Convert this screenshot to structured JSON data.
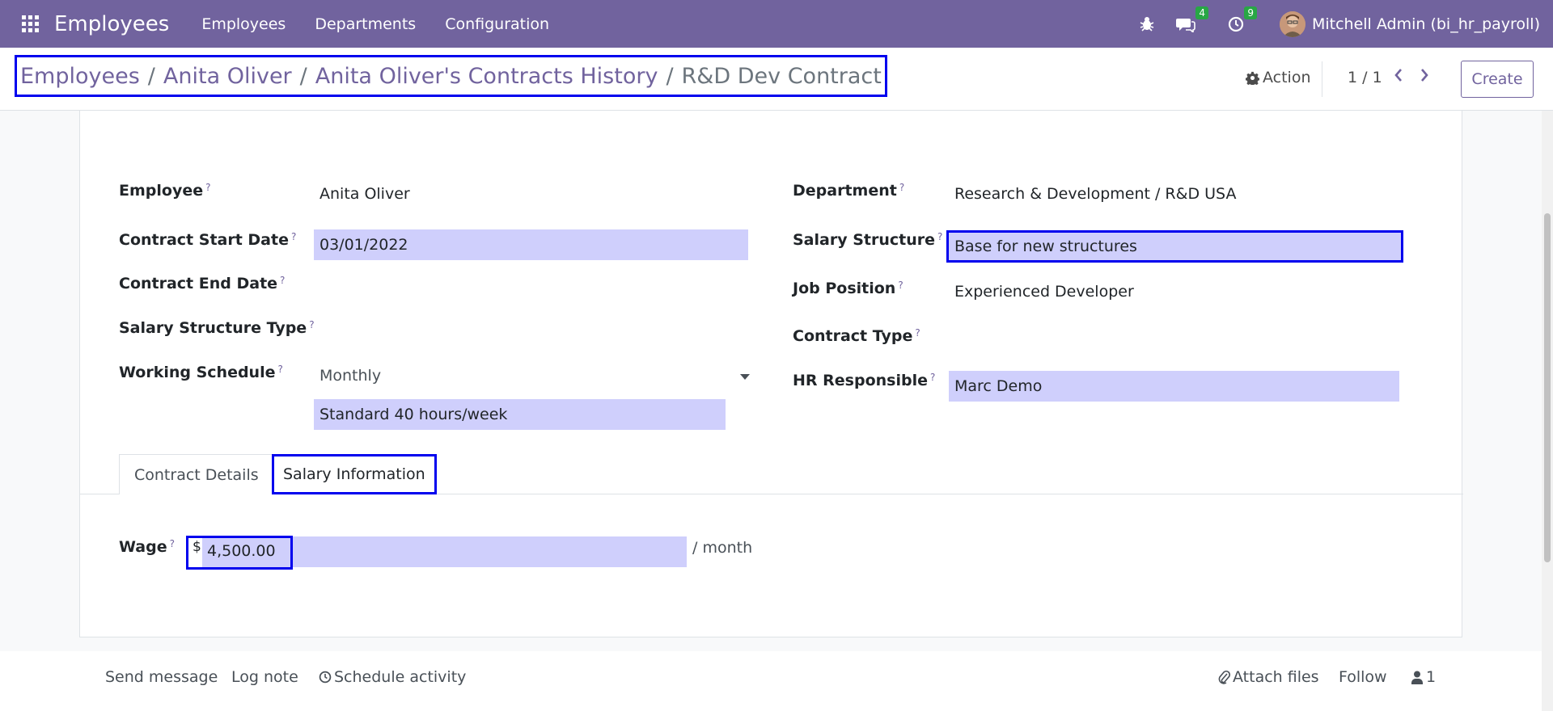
{
  "navbar": {
    "app_name": "Employees",
    "menu": [
      "Employees",
      "Departments",
      "Configuration"
    ],
    "messages_count": "4",
    "activities_count": "9",
    "user": "Mitchell Admin (bi_hr_payroll)",
    "color": "#71639e"
  },
  "breadcrumb": {
    "items": [
      "Employees",
      "Anita Oliver",
      "Anita Oliver's Contracts History"
    ],
    "sep": "/",
    "current": "R&D Dev Contract"
  },
  "control": {
    "action_label": "Action",
    "pager": "1 / 1",
    "create_label": "Create"
  },
  "form": {
    "employee_label": "Employee",
    "employee_value": "Anita Oliver",
    "start_date_label": "Contract Start Date",
    "start_date_value": "03/01/2022",
    "end_date_label": "Contract End Date",
    "structure_type_label": "Salary Structure Type",
    "schedule_label": "Working Schedule",
    "schedule_period": "Monthly",
    "schedule_value": "Standard 40 hours/week",
    "department_label": "Department",
    "department_value": "Research & Development / R&D USA",
    "salary_structure_label": "Salary Structure",
    "salary_structure_value": "Base for new structures",
    "job_position_label": "Job Position",
    "job_position_value": "Experienced Developer",
    "contract_type_label": "Contract Type",
    "hr_responsible_label": "HR Responsible",
    "hr_responsible_value": "Marc Demo",
    "help_mark": "?"
  },
  "tabs": [
    "Contract Details",
    "Salary Information"
  ],
  "salary": {
    "wage_label": "Wage",
    "currency": "$",
    "wage_value": "4,500.00",
    "per": "/ month"
  },
  "chatter": {
    "send_message": "Send message",
    "log_note": "Log note",
    "schedule_activity": "Schedule activity",
    "attach_files": "Attach files",
    "follow": "Follow",
    "followers_count": "1"
  }
}
